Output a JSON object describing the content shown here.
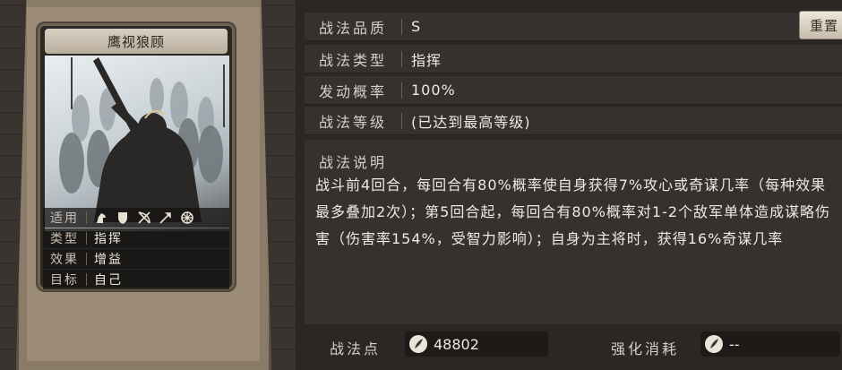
{
  "card": {
    "title": "鹰视狼顾",
    "stats": [
      {
        "label": "适用",
        "value": ""
      },
      {
        "label": "类型",
        "value": "指挥"
      },
      {
        "label": "效果",
        "value": "增益"
      },
      {
        "label": "目标",
        "value": "自己"
      }
    ],
    "unit_icons": [
      "cavalry-icon",
      "shield-icon",
      "bow-icon",
      "spear-icon",
      "siege-wheel-icon"
    ]
  },
  "tactic": {
    "quality_label": "战法品质",
    "quality_value": "S",
    "type_label": "战法类型",
    "type_value": "指挥",
    "trigger_label": "发动概率",
    "trigger_value": "100%",
    "level_label": "战法等级",
    "level_value": "(已达到最高等级)",
    "reset_label": "重置",
    "desc_title": "战法说明",
    "desc_text": "战斗前4回合，每回合有80%概率使自身获得7%攻心或奇谋几率（每种效果最多叠加2次）；第5回合起，每回合有80%概率对1-2个敌军单体造成谋略伤害（伤害率154%，受智力影响）；自身为主将时，获得16%奇谋几率"
  },
  "footer": {
    "points_label": "战法点",
    "points_value": "48802",
    "cost_label": "强化消耗",
    "cost_value": "--"
  }
}
